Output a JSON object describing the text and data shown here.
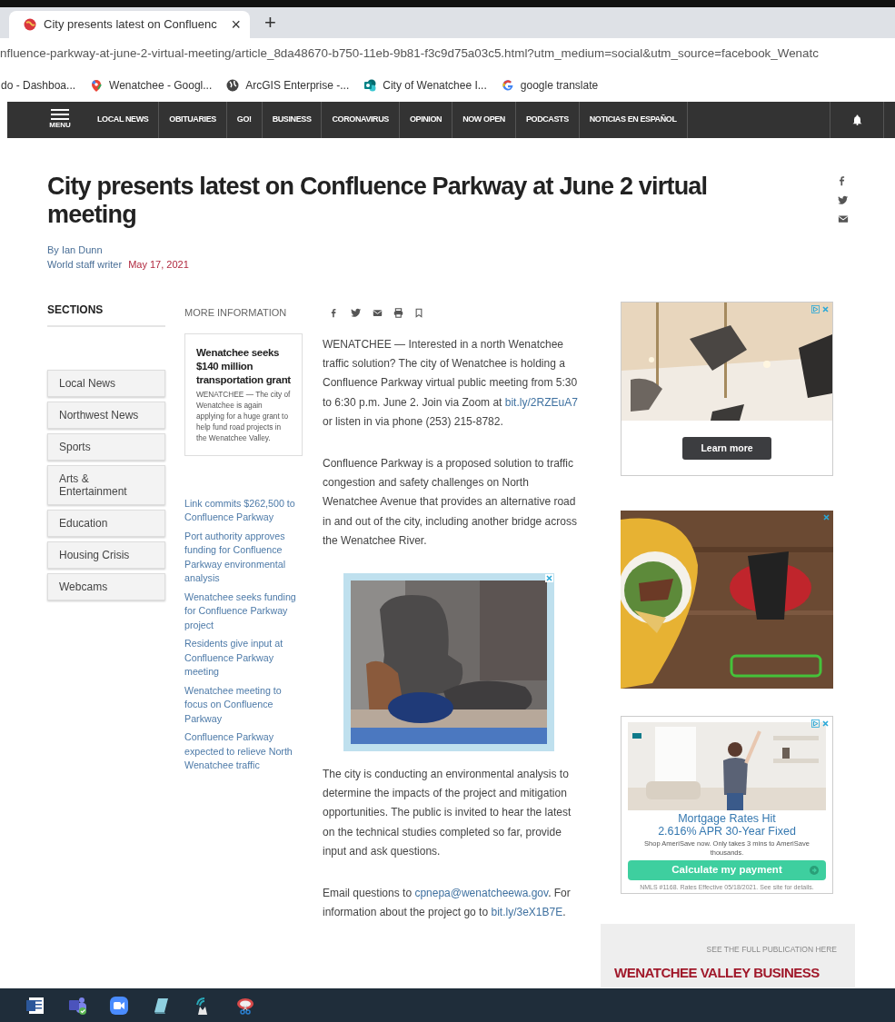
{
  "browser": {
    "tabs": [
      {
        "title": "City presents latest on Confluenc",
        "close": "×",
        "selected": true
      }
    ],
    "new_tab": "+",
    "url": "nfluence-parkway-at-june-2-virtual-meeting/article_8da48670-b750-11eb-9b81-f3c9d75a03c5.html?utm_medium=social&utm_source=facebook_Wenatc",
    "bookmarks": [
      {
        "label": "do - Dashboa..."
      },
      {
        "label": "Wenatchee - Googl..."
      },
      {
        "label": "ArcGIS Enterprise -..."
      },
      {
        "label": "City of Wenatchee I..."
      },
      {
        "label": "google translate"
      }
    ]
  },
  "site_nav": {
    "menu_label": "MENU",
    "items": [
      "LOCAL NEWS",
      "OBITUARIES",
      "GO!",
      "BUSINESS",
      "CORONAVIRUS",
      "OPINION",
      "NOW OPEN",
      "PODCASTS",
      "NOTICIAS EN ESPAÑOL"
    ]
  },
  "article": {
    "title": "City presents latest on Confluence Parkway at June 2 virtual meeting",
    "author": "By Ian Dunn",
    "role": "World staff writer",
    "date": "May 17, 2021",
    "body": [
      [
        {
          "text": "WENATCHEE — Interested in a north Wenatchee traffic solution? The city of Wenatchee is holding a Confluence Parkway virtual public meeting from 5:30 to 6:30 p.m. June 2. Join via Zoom at "
        },
        {
          "link": "bit.ly/2RZEuA7"
        },
        {
          "text": " or listen in via phone (253) 215-8782."
        }
      ],
      [
        {
          "text": "Confluence Parkway is a proposed solution to traffic congestion and safety challenges on North Wenatchee Avenue that provides an alternative road in and out of the city, including another bridge across the Wenatchee River."
        }
      ],
      [
        {
          "kind": "ad"
        }
      ],
      [
        {
          "text": "The city is conducting an environmental analysis to determine the impacts of the project and mitigation opportunities. The public is invited to hear the latest on the technical studies completed so far, provide input and ask questions."
        }
      ],
      [
        {
          "text": "Email questions to "
        },
        {
          "link": "cpnepa@wenatcheewa.gov"
        },
        {
          "text": ". For information about the project go to "
        },
        {
          "link": "bit.ly/3eX1B7E"
        },
        {
          "text": "."
        }
      ]
    ]
  },
  "sections": {
    "heading": "SECTIONS",
    "items": [
      "Local News",
      "Northwest News",
      "Sports",
      "Arts & Entertainment",
      "Education",
      "Housing Crisis",
      "Webcams"
    ]
  },
  "more_info": {
    "heading": "MORE INFORMATION",
    "featured": {
      "title": "Wenatchee seeks $140 million transportation grant",
      "summary": "WENATCHEE — The city of Wenatchee is again applying for a huge grant to help fund road projects in the Wenatchee Valley."
    },
    "links": [
      "Link commits $262,500 to Confluence Parkway",
      "Port authority approves funding for Confluence Parkway environmental analysis",
      "Wenatchee seeks funding for Confluence Parkway project",
      "Residents give input at Confluence Parkway meeting",
      "Wenatchee meeting to focus on Confluence Parkway",
      "Confluence Parkway expected to relieve North Wenatchee traffic"
    ]
  },
  "ads": [
    {
      "kind": "video",
      "button": "Learn more"
    },
    {
      "kind": "picture"
    },
    {
      "kind": "mortgage",
      "headline": [
        "Mortgage Rates Hit",
        "2.616% APR 30-Year Fixed"
      ],
      "subtext": "Shop AmeriSave now. Only takes 3 mins to AmeriSave thousands.",
      "button": "Calculate my payment",
      "disclaimer": "NMLS #1168. Rates Effective 05/18/2021. See site for details."
    }
  ],
  "publication": {
    "caption": "SEE THE FULL PUBLICATION HERE",
    "title": "WENATCHEE VALLEY BUSINESS"
  }
}
